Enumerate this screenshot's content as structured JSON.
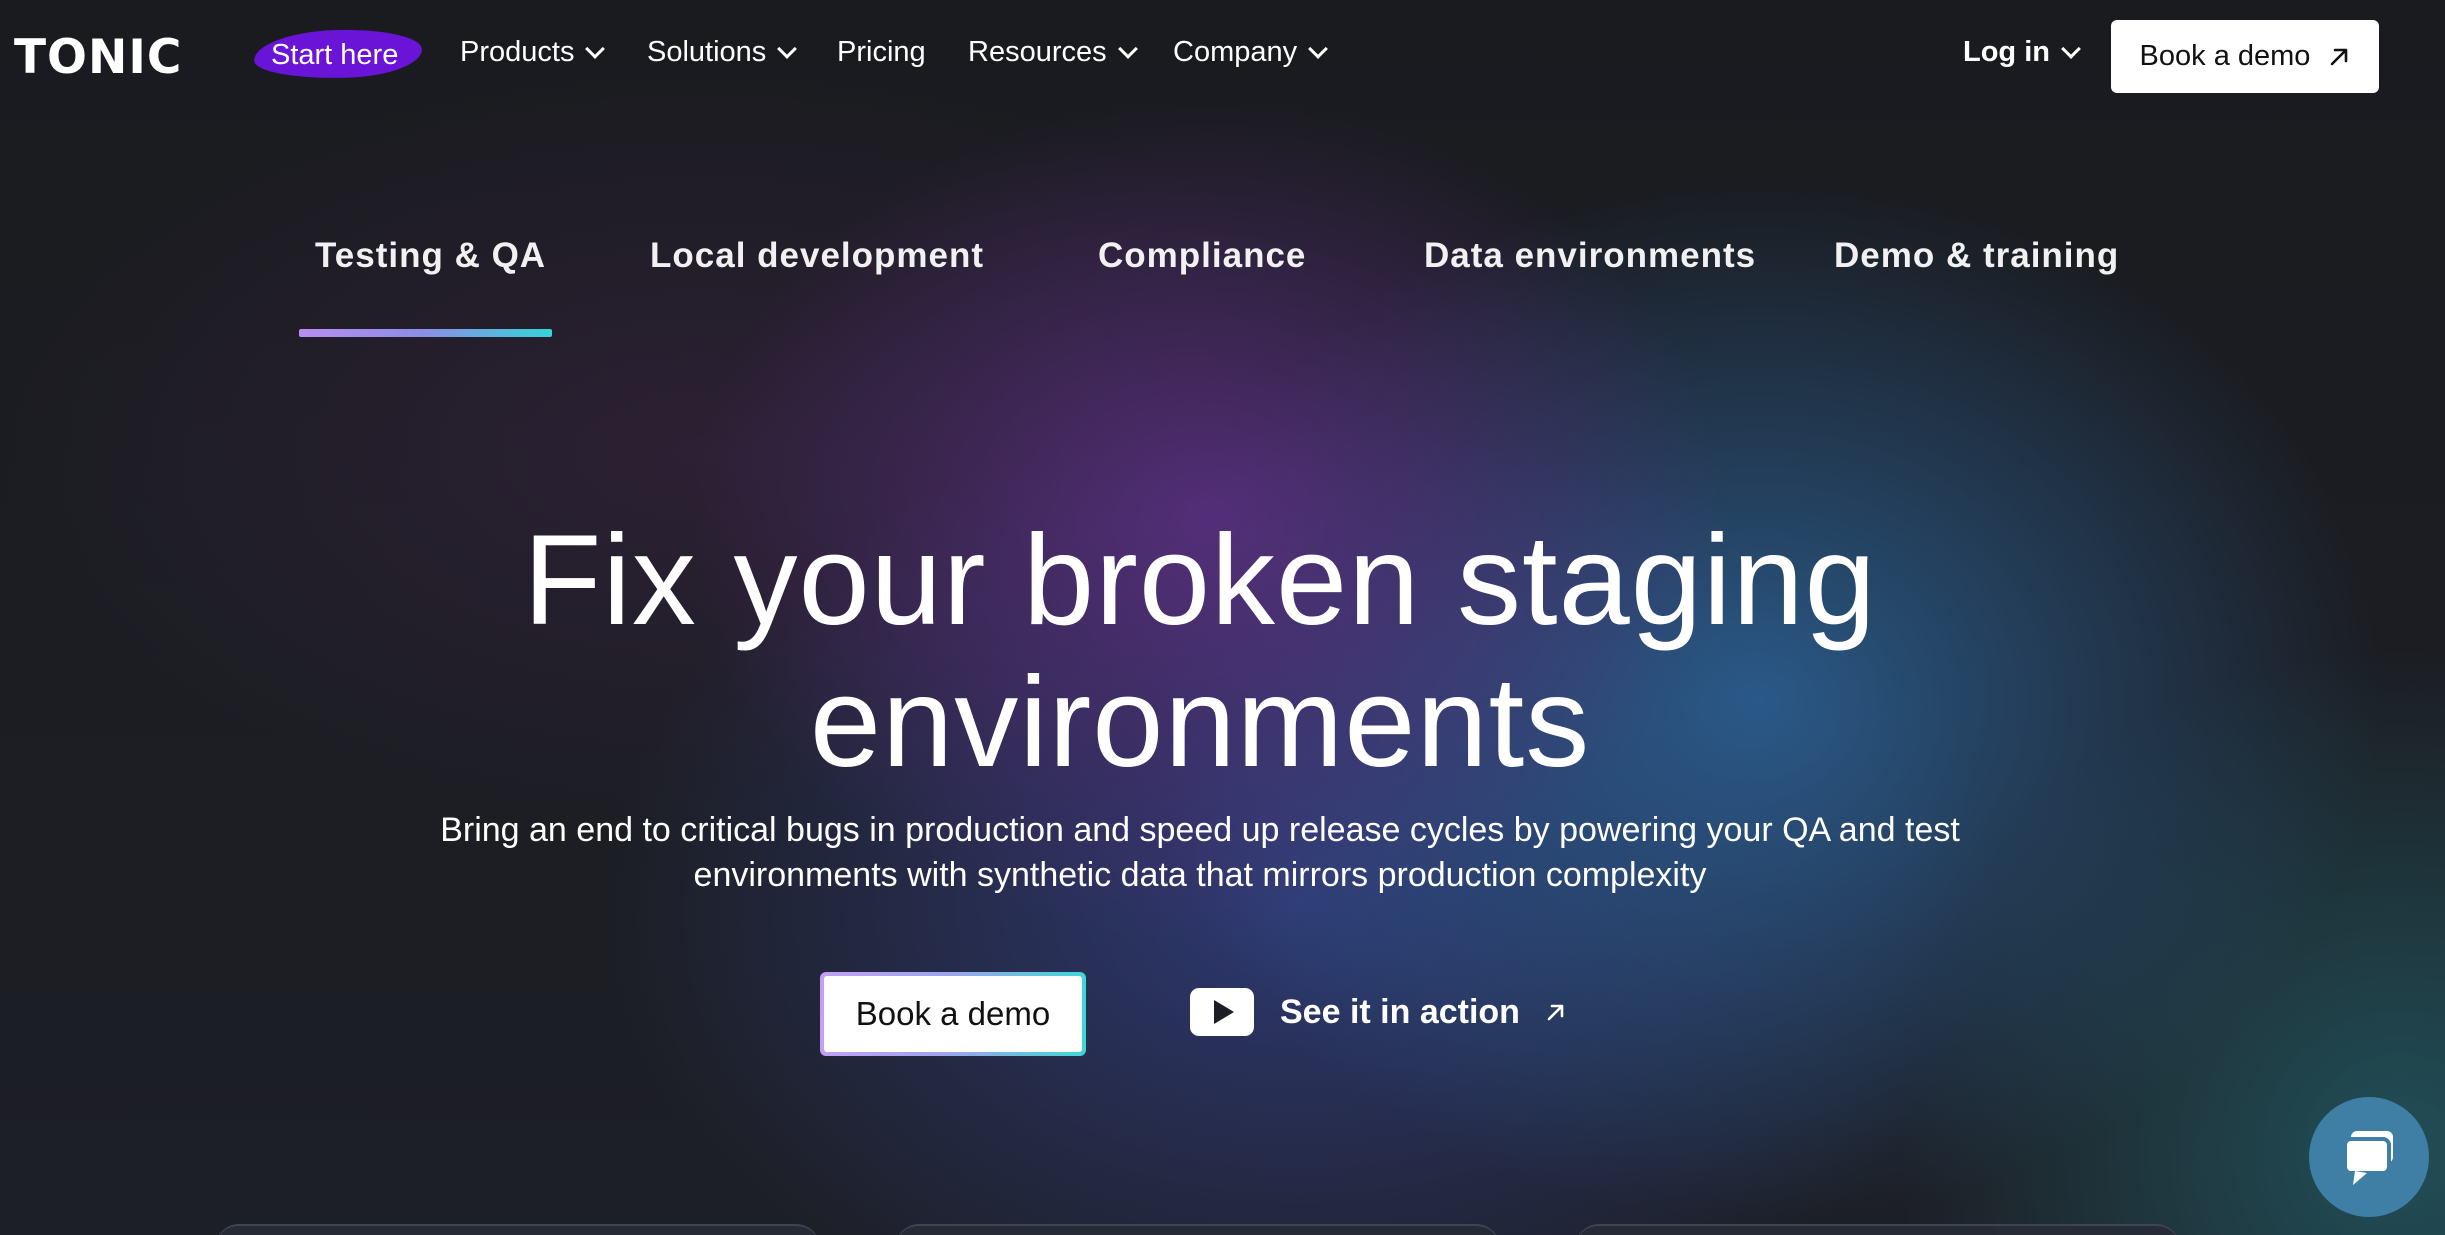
{
  "brand": {
    "logo_text": "TONIC"
  },
  "nav": {
    "start_here": "Start here",
    "items": [
      {
        "label": "Products",
        "has_dropdown": true
      },
      {
        "label": "Solutions",
        "has_dropdown": true
      },
      {
        "label": "Pricing",
        "has_dropdown": false
      },
      {
        "label": "Resources",
        "has_dropdown": true
      },
      {
        "label": "Company",
        "has_dropdown": true
      }
    ],
    "login": "Log in",
    "book_demo": "Book a demo"
  },
  "tabs": {
    "items": [
      {
        "label": "Testing & QA",
        "active": true
      },
      {
        "label": "Local development",
        "active": false
      },
      {
        "label": "Compliance",
        "active": false
      },
      {
        "label": "Data environments",
        "active": false
      },
      {
        "label": "Demo & training",
        "active": false
      }
    ]
  },
  "hero": {
    "title_line1": "Fix your broken staging",
    "title_line2": "environments",
    "subtitle_line1": "Bring an end to critical bugs in production and speed up release cycles by powering your QA and test",
    "subtitle_line2": "environments with synthetic data that mirrors production complexity",
    "primary_button": "Book a demo",
    "secondary_button": "See it in action"
  },
  "colors": {
    "start_here_highlight": "#6a14d8",
    "tab_underline_start": "#b68ff0",
    "tab_underline_end": "#33d5d8",
    "chat_button": "#3f7fa6"
  },
  "icons": [
    "chevron-down-icon",
    "arrow-up-right-icon",
    "play-icon",
    "chat-icon"
  ]
}
